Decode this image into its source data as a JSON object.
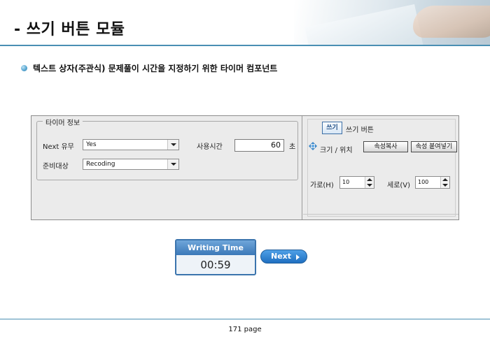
{
  "header": {
    "title": "- 쓰기 버튼 모듈"
  },
  "bullet": {
    "text": "텍스트 상자(주관식) 문제풀이 시간을 지정하기 위한 타이머 컴포넌트"
  },
  "timer_panel": {
    "group_title": "타이머 정보",
    "next_label": "Next 유무",
    "next_value": "Yes",
    "prep_label": "준비대상",
    "prep_value": "Recoding",
    "time_label": "사용시간",
    "time_value": "60",
    "time_unit": "초"
  },
  "write_panel": {
    "button_label": "쓰기",
    "title": "쓰기 버튼",
    "size_pos_label": "크기 / 위치",
    "copy_button": "속성복사",
    "paste_button": "속성 붙여넣기",
    "width_label": "가로(H)",
    "width_value": "10",
    "height_label": "세로(V)",
    "height_value": "100"
  },
  "writing_time": {
    "title": "Writing Time",
    "time": "00:59",
    "next_button": "Next"
  },
  "footer": {
    "page": "171 page"
  }
}
